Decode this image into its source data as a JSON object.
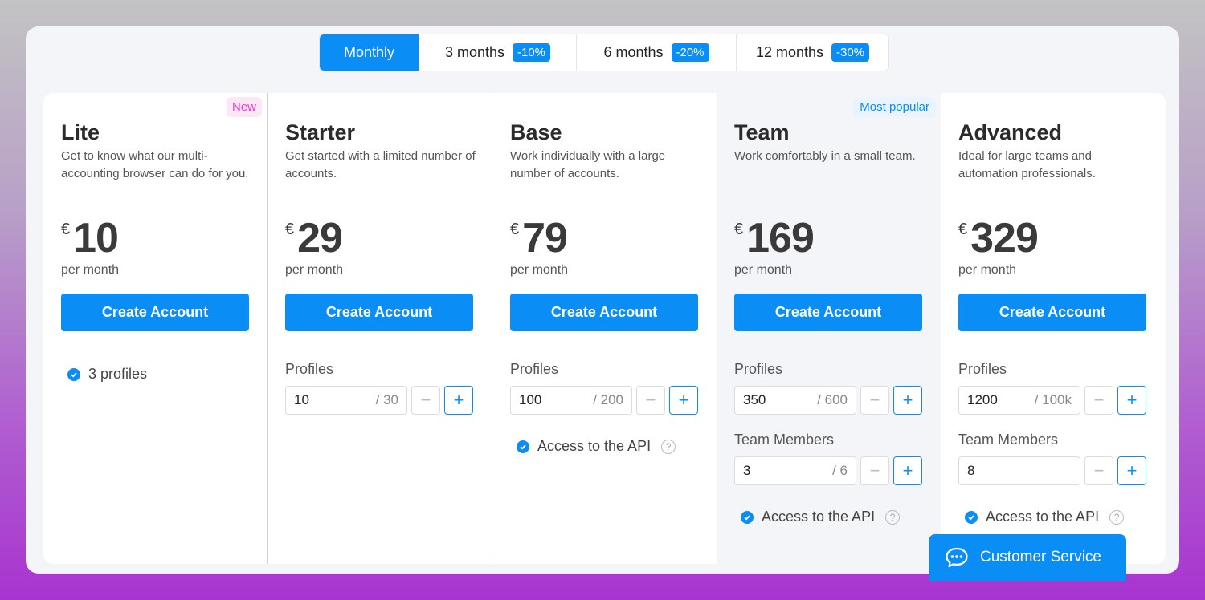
{
  "periods": [
    {
      "label": "Monthly",
      "discount": ""
    },
    {
      "label": "3 months",
      "discount": "-10%"
    },
    {
      "label": "6 months",
      "discount": "-20%"
    },
    {
      "label": "12 months",
      "discount": "-30%"
    }
  ],
  "selected_period": "Monthly",
  "plans": [
    {
      "badge": "New",
      "name": "Lite",
      "description": "Get to know what our multi-accounting browser can do for you.",
      "currency": "€",
      "price": "10",
      "per": "per month",
      "cta": "Create Account",
      "feature": "3 profiles"
    },
    {
      "name": "Starter",
      "description": "Get started with a limited number of accounts.",
      "currency": "€",
      "price": "29",
      "per": "per month",
      "cta": "Create Account",
      "profiles_label": "Profiles",
      "profiles_value": "10",
      "profiles_max": "/ 30"
    },
    {
      "name": "Base",
      "description": "Work individually with a large number of accounts.",
      "currency": "€",
      "price": "79",
      "per": "per month",
      "cta": "Create Account",
      "profiles_label": "Profiles",
      "profiles_value": "100",
      "profiles_max": "/ 200",
      "feature": "Access to the API"
    },
    {
      "badge": "Most popular",
      "name": "Team",
      "description": "Work comfortably in a small team.",
      "currency": "€",
      "price": "169",
      "per": "per month",
      "cta": "Create Account",
      "profiles_label": "Profiles",
      "profiles_value": "350",
      "profiles_max": "/ 600",
      "members_label": "Team Members",
      "members_value": "3",
      "members_max": "/ 6",
      "feature": "Access to the API"
    },
    {
      "name": "Advanced",
      "description": "Ideal for large teams and automation professionals.",
      "currency": "€",
      "price": "329",
      "per": "per month",
      "cta": "Create Account",
      "profiles_label": "Profiles",
      "profiles_value": "1200",
      "profiles_max": "/ 100k",
      "members_label": "Team Members",
      "members_value": "8",
      "feature": "Access to the API"
    }
  ],
  "stepper": {
    "minus": "−",
    "plus": "+"
  },
  "help_icon": "?",
  "customer_service": "Customer Service",
  "colors": {
    "accent": "#0a8df5",
    "new_badge": "#ea3fc8"
  }
}
